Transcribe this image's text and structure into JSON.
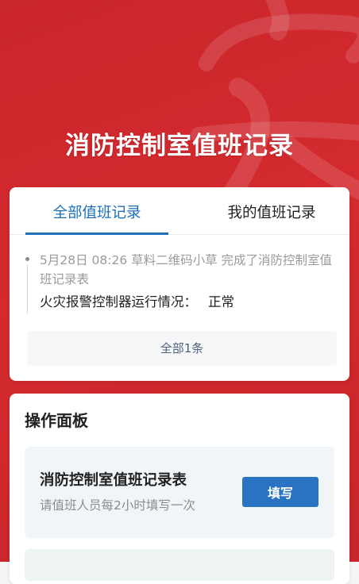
{
  "header": {
    "title": "消防控制室值班记录"
  },
  "tabs": [
    {
      "label": "全部值班记录",
      "active": true
    },
    {
      "label": "我的值班记录",
      "active": false
    }
  ],
  "records": [
    {
      "meta": "5月28日 08:26  草料二维码小草 完成了消防控制室值班记录表",
      "status_label": "火灾报警控制器运行情况：",
      "status_value": "正常"
    }
  ],
  "records_footer": {
    "all_count_label": "全部1条"
  },
  "panel": {
    "title": "操作面板",
    "items": [
      {
        "title": "消防控制室值班记录表",
        "subtitle": "请值班人员每2小时填写一次",
        "button_label": "填写"
      }
    ]
  },
  "colors": {
    "brand_red": "#d42a2f",
    "accent_blue": "#1d6fb8",
    "button_blue": "#2a72c2"
  }
}
